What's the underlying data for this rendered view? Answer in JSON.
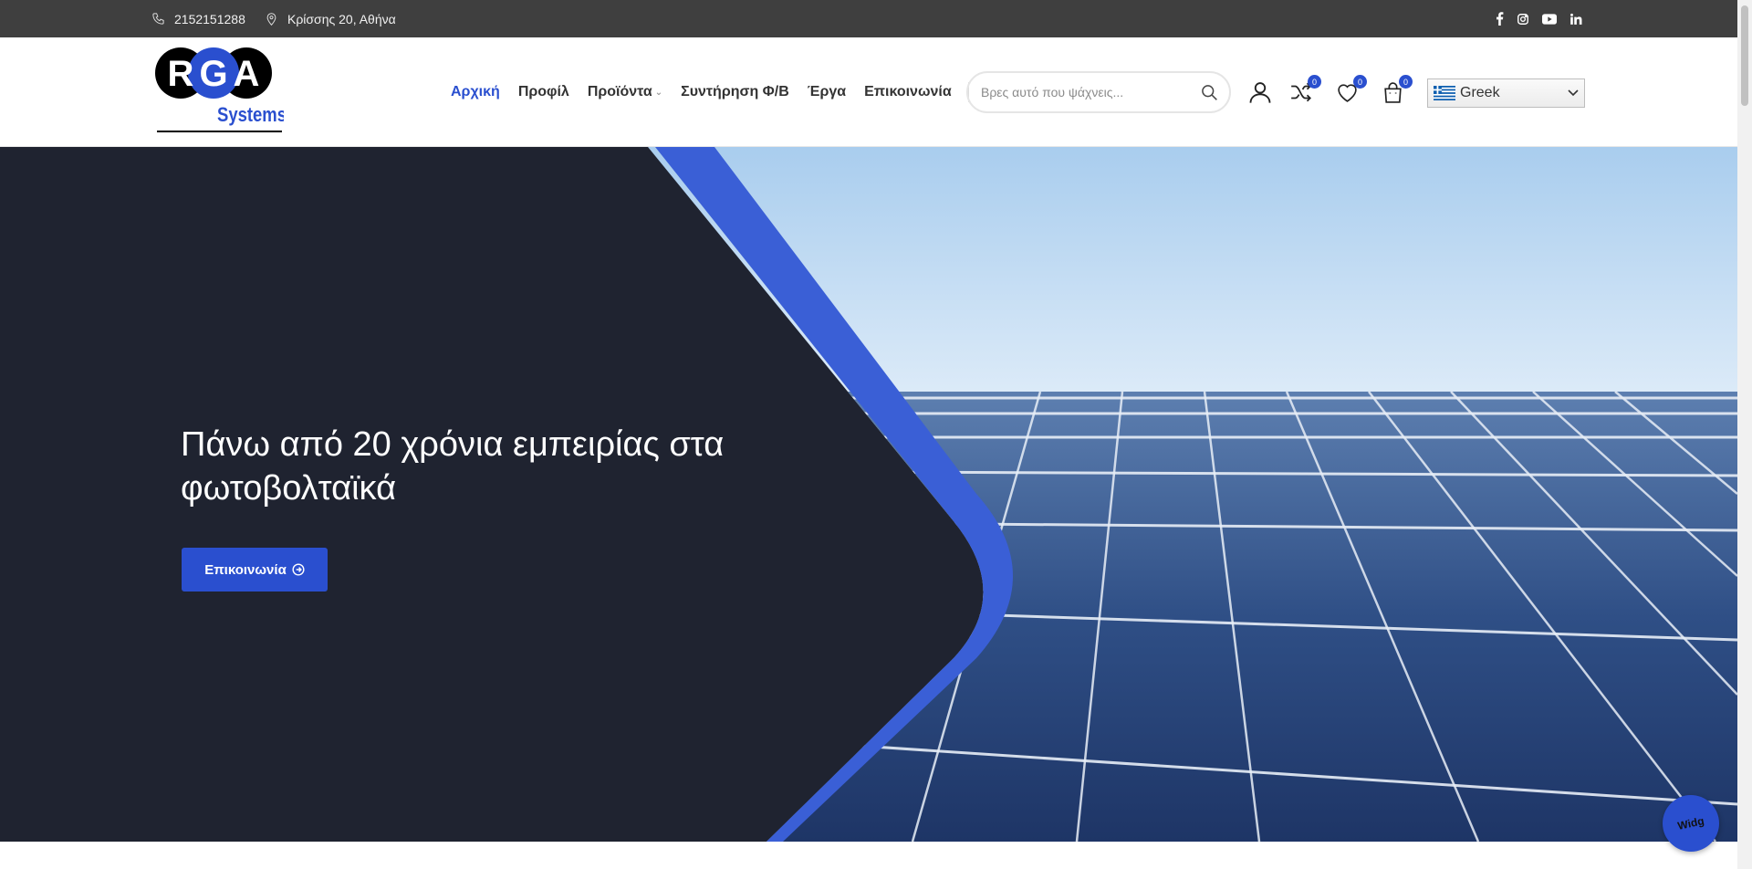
{
  "topbar": {
    "phone": "2152151288",
    "address": "Κρίσσης 20, Αθήνα",
    "social": [
      "facebook-icon",
      "instagram-icon",
      "youtube-icon",
      "linkedin-icon"
    ]
  },
  "header": {
    "logo": {
      "letters": [
        "R",
        "G",
        "A"
      ],
      "subtitle": "Systems"
    },
    "nav": [
      {
        "label": "Αρχική",
        "active": true
      },
      {
        "label": "Προφίλ"
      },
      {
        "label": "Προϊόντα",
        "has_dropdown": true
      },
      {
        "label": "Συντήρηση Φ/Β"
      },
      {
        "label": "Έργα"
      },
      {
        "label": "Επικοινωνία"
      }
    ],
    "search_placeholder": "Βρες αυτό που ψάχνεις...",
    "compare_count": "0",
    "wishlist_count": "0",
    "cart_count": "0",
    "language": "Greek"
  },
  "hero": {
    "title": "Πάνω από 20 χρόνια εμπειρίας στα φωτοβολταϊκά",
    "button_label": "Επικοινωνία"
  },
  "widget": {
    "label": "Widg"
  },
  "colors": {
    "topbar": "#3f3f3f",
    "accent": "#2a4fcf",
    "hero_dark": "#1f2330"
  }
}
